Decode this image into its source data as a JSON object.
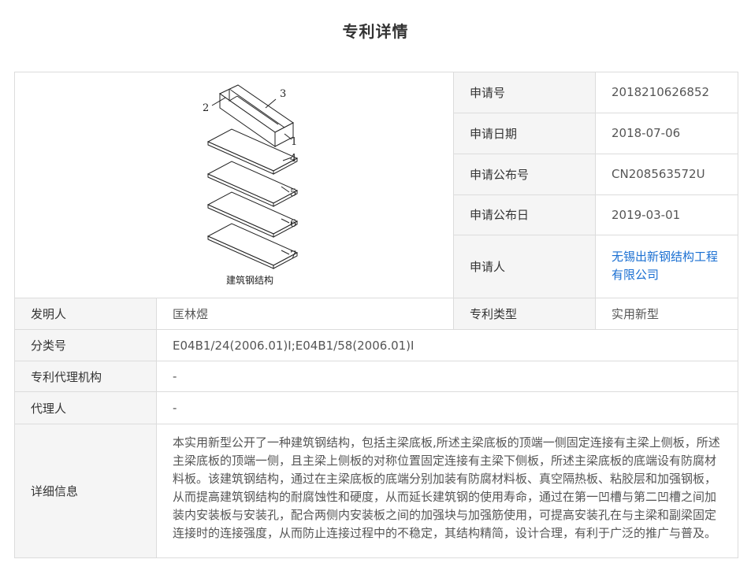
{
  "page": {
    "title": "专利详情"
  },
  "figure": {
    "caption": "建筑钢结构",
    "labels": [
      "1",
      "2",
      "3",
      "4",
      "5",
      "6",
      "7"
    ]
  },
  "fields": {
    "app_number": {
      "label": "申请号",
      "value": "2018210626852"
    },
    "app_date": {
      "label": "申请日期",
      "value": "2018-07-06"
    },
    "pub_number": {
      "label": "申请公布号",
      "value": "CN208563572U"
    },
    "pub_date": {
      "label": "申请公布日",
      "value": "2019-03-01"
    },
    "applicant": {
      "label": "申请人",
      "value": "无锡出新钢结构工程有限公司"
    },
    "inventor": {
      "label": "发明人",
      "value": "匡林煜"
    },
    "patent_type": {
      "label": "专利类型",
      "value": "实用新型"
    },
    "classification": {
      "label": "分类号",
      "value": "E04B1/24(2006.01)I;E04B1/58(2006.01)I"
    },
    "agency": {
      "label": "专利代理机构",
      "value": "-"
    },
    "agent": {
      "label": "代理人",
      "value": "-"
    },
    "details": {
      "label": "详细信息",
      "value": "本实用新型公开了一种建筑钢结构，包括主梁底板,所述主梁底板的顶端一侧固定连接有主梁上侧板，所述主梁底板的顶端一侧，且主梁上侧板的对称位置固定连接有主梁下侧板，所述主梁底板的底端设有防腐材料板。该建筑钢结构，通过在主梁底板的底端分别加装有防腐材料板、真空隔热板、粘胶层和加强钢板，从而提高建筑钢结构的耐腐蚀性和硬度，从而延长建筑钢的使用寿命，通过在第一凹槽与第二凹槽之间加装内安装板与安装孔，配合两侧内安装板之间的加强块与加强筋使用，可提高安装孔在与主梁和副梁固定连接时的连接强度，从而防止连接过程中的不稳定，其结构精简，设计合理，有利于广泛的推广与普及。"
    }
  },
  "colors": {
    "link": "#1a6fd2",
    "label_bg": "#f5f5f5",
    "border": "#dcdcdc"
  }
}
